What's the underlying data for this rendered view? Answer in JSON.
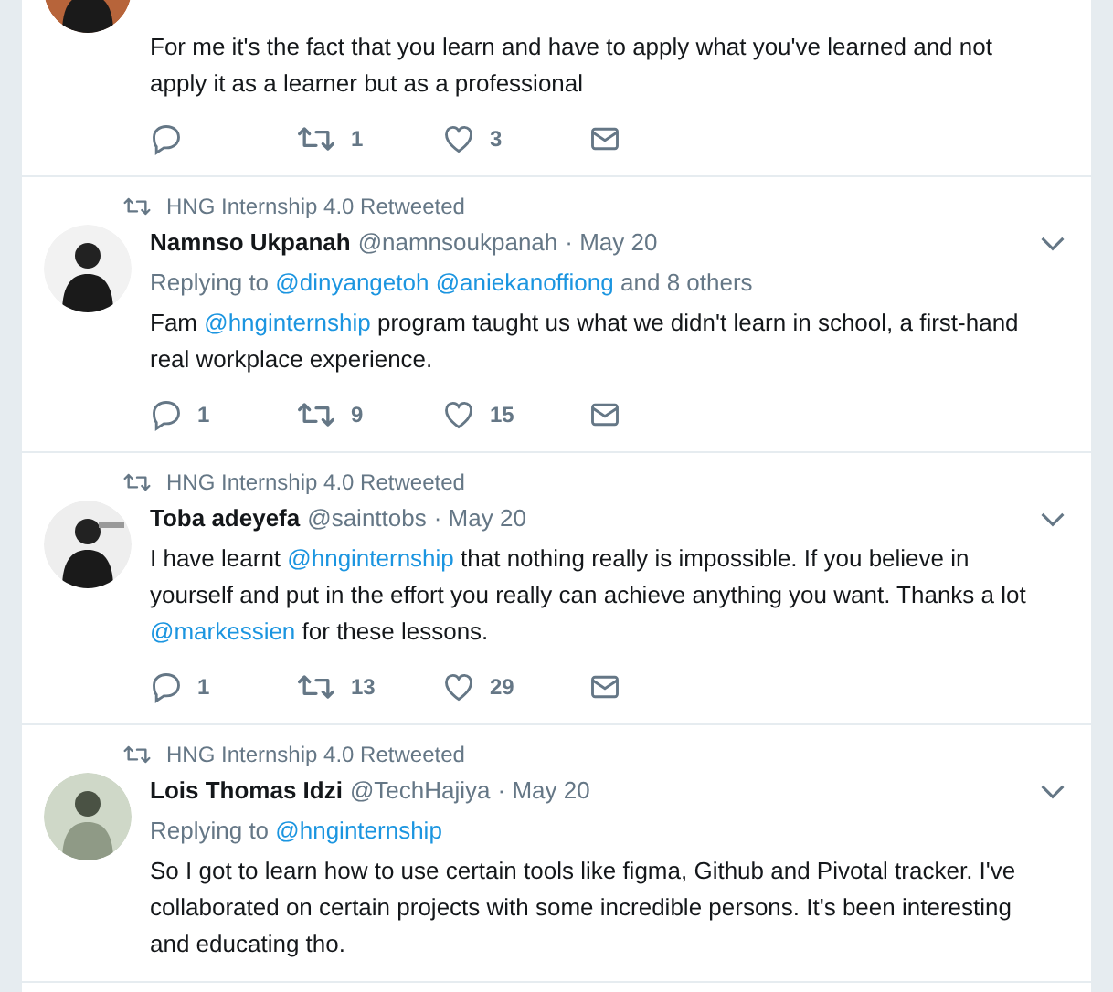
{
  "tweets": [
    {
      "body": [
        {
          "kind": "text",
          "text": "For me it's the fact that you learn and have to apply what you've learned and not apply it as a learner but as a professional"
        }
      ],
      "actions": [
        {
          "kind": "reply"
        },
        {
          "kind": "retweet",
          "count": "1"
        },
        {
          "kind": "like",
          "count": "3"
        },
        {
          "kind": "dm"
        }
      ]
    },
    {
      "retweeted_by": "HNG Internship 4.0 Retweeted",
      "name": "Namnso Ukpanah",
      "handle": "@namnsoukpanah",
      "date": "· May 20",
      "replying": [
        {
          "kind": "text",
          "text": "Replying to"
        },
        {
          "kind": "mention",
          "text": "@dinyangetoh"
        },
        {
          "kind": "mention",
          "text": "@aniekanoffiong"
        },
        {
          "kind": "text",
          "text": "and 8 others"
        }
      ],
      "body": [
        {
          "kind": "text",
          "text": "Fam "
        },
        {
          "kind": "mention",
          "text": "@hnginternship"
        },
        {
          "kind": "text",
          "text": " program taught us what we didn't learn in school, a first-hand real workplace experience."
        }
      ],
      "actions": [
        {
          "kind": "reply",
          "count": "1"
        },
        {
          "kind": "retweet",
          "count": "9"
        },
        {
          "kind": "like",
          "count": "15"
        },
        {
          "kind": "dm"
        }
      ]
    },
    {
      "retweeted_by": "HNG Internship 4.0 Retweeted",
      "name": "Toba adeyefa",
      "handle": "@sainttobs",
      "date": "· May 20",
      "body": [
        {
          "kind": "text",
          "text": "I have learnt "
        },
        {
          "kind": "mention",
          "text": "@hnginternship"
        },
        {
          "kind": "text",
          "text": " that nothing really is impossible. If you believe in yourself and put in the effort you really can achieve anything you want. Thanks a lot "
        },
        {
          "kind": "mention",
          "text": "@markessien"
        },
        {
          "kind": "text",
          "text": " for these lessons."
        }
      ],
      "actions": [
        {
          "kind": "reply",
          "count": "1"
        },
        {
          "kind": "retweet",
          "count": "13"
        },
        {
          "kind": "like",
          "count": "29"
        },
        {
          "kind": "dm"
        }
      ]
    },
    {
      "retweeted_by": "HNG Internship 4.0 Retweeted",
      "name": "Lois Thomas Idzi",
      "handle": "@TechHajiya",
      "date": "· May 20",
      "replying": [
        {
          "kind": "text",
          "text": "Replying to"
        },
        {
          "kind": "mention",
          "text": "@hnginternship"
        }
      ],
      "body": [
        {
          "kind": "text",
          "text": "So I got to learn how to use certain tools like figma, Github and Pivotal tracker. I've collaborated on certain projects with some incredible persons. It's been interesting and educating tho."
        }
      ]
    }
  ]
}
